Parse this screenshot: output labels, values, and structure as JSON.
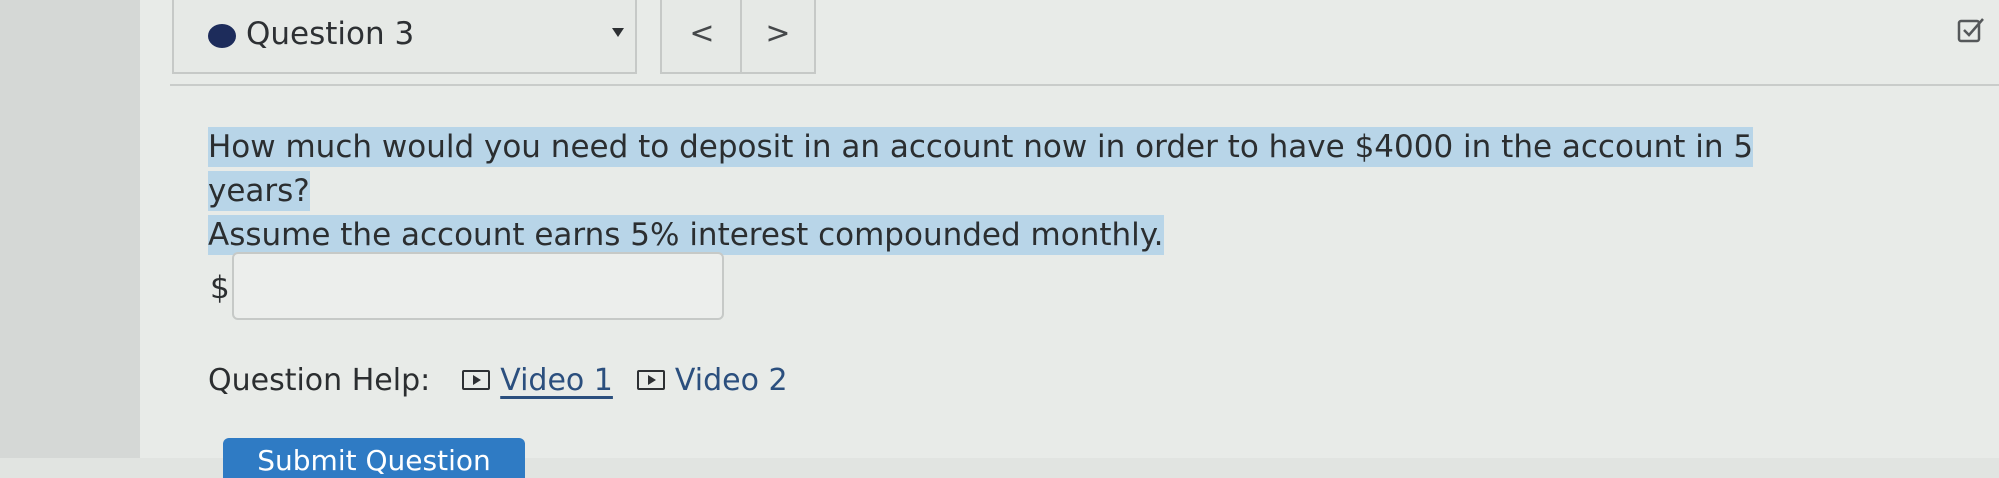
{
  "header": {
    "question_label": "Question 3",
    "prev_label": "<",
    "next_label": ">"
  },
  "question": {
    "line1": "How much would you need to deposit in an account now in order to have $4000 in the account in 5 years?",
    "line2": "Assume the account earns 5% interest compounded monthly."
  },
  "answer": {
    "currency_symbol": "$",
    "value": ""
  },
  "help": {
    "label": "Question Help:",
    "video1": "Video 1",
    "video2": "Video 2"
  },
  "actions": {
    "submit_label": "Submit Question"
  },
  "colors": {
    "highlight": "#b8d5e8",
    "link": "#2b4f7e",
    "submit_button": "#2f7bc4",
    "status_dot": "#1d2c5b"
  }
}
